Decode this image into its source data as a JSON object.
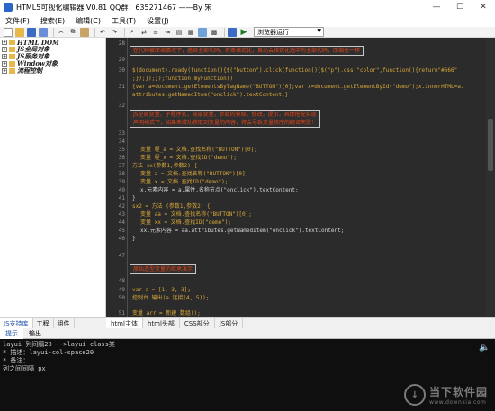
{
  "window": {
    "title": "HTML5可视化编辑器 V0.81 QQ群：635271467 ——By 宋",
    "minimize": "—",
    "maximize": "☐",
    "close": "✕"
  },
  "menu": [
    "文件(F)",
    "搜索(E)",
    "编辑(C)",
    "工具(T)",
    "设置(J)"
  ],
  "toolbar": {
    "run_mode": "浏览器运行"
  },
  "tree": [
    {
      "label": "HTML DOM",
      "expanded": true
    },
    {
      "label": "JS全局对象",
      "expanded": false
    },
    {
      "label": "JS服务对象",
      "expanded": false
    },
    {
      "label": "Window对象",
      "expanded": false
    },
    {
      "label": "流程控制",
      "expanded": false
    }
  ],
  "left_tabs": [
    "JS支持库",
    "工程",
    "组件"
  ],
  "code": {
    "box1": "在代码被压缩情况下，选择全部代码，右击格式化，自动会格式化选中的全部代码，压缩也一样",
    "l28": "28",
    "l29": "29",
    "l30": "30",
    "l30_code": "$(document).ready(function(){$(\"button\").click(function(){$(\"p\").css(\"color\",function(){return\"#666\"",
    "l30b_code": ";});});});function myFunction()",
    "l31": "31",
    "l31_code": "{var a=document.getElementsByTagName(\"BUTTON\")[0];var x=document.getElementById(\"demo\");x.innerHTML=a.",
    "l31b_code": "attributes.getNamedItem(\"onclick\").textContent;}",
    "l32": "32",
    "box2a": "JS全局变量，子程序名，局部变量，参数的获取，修改，提示，具体搭配实现",
    "box2b": "声明格式下，如果未成功获取到变量的内容，将会导致变量修序的翻译失败！",
    "l33": "33",
    "l34": "34",
    "l35": "35",
    "l35_code": "变量 程_a = 文档.查找名称(\"BUTTON\")[0];",
    "l36": "36",
    "l36_code": "变量 程_x = 文档.查找ID(\"demo\");",
    "l37": "37",
    "l37_code": "方法 sx(参数1,参数2) {",
    "l38": "38",
    "l38_code": "变量 a = 文档.查找名称(\"BUTTON\")[0];",
    "l39": "39",
    "l39_code": "变量 x = 文档.查找ID(\"demo\");",
    "l40": "40",
    "l40_code": "x.元素内容 = a.属性.名称节点(\"onclick\").textContent;",
    "l41": "41",
    "l41_code": "}",
    "l42": "42",
    "l42_code": "sx2 = 方法 (参数1,参数2) {",
    "l43": "43",
    "l43_code": "变量 aa = 文档.查找名称(\"BUTTON\")[0];",
    "l44": "44",
    "l44_code": "变量 xx = 文档.查找ID(\"demo\");",
    "l45": "45",
    "l45_code": "xx.元素内容 = aa.attributes.getNamedItem(\"onclick\").textContent;",
    "l46": "46",
    "l46_code": "}",
    "l47": "47",
    "box3": "原始造型变量的继承演示",
    "l48": "48",
    "l49": "49",
    "l49_code": "var a = [1, 3, 3];",
    "l50": "50",
    "l50_code": "控制台.输出(a.连接(4, 5));",
    "l51": "51",
    "l51_code": "变量 arr = 新建 数组();"
  },
  "editor_tabs": [
    "html主体",
    "html头部",
    "CSS部分",
    "JS部分"
  ],
  "output_tabs": [
    "提示",
    "输出"
  ],
  "output_lines": [
    "layui 列间隔20 -->layui class类",
    "* 描述：layui-col-space20",
    "* 备注：",
    "列之间间隔 px"
  ],
  "watermark": {
    "cn": "当下软件园",
    "en": "www.downxia.com"
  },
  "colors": {
    "keyword": "#d8a83a",
    "string": "#e06c75",
    "comment_box_text": "#e0451a",
    "editor_bg": "#2b2b2b",
    "output_bg": "#0f0f0f"
  }
}
